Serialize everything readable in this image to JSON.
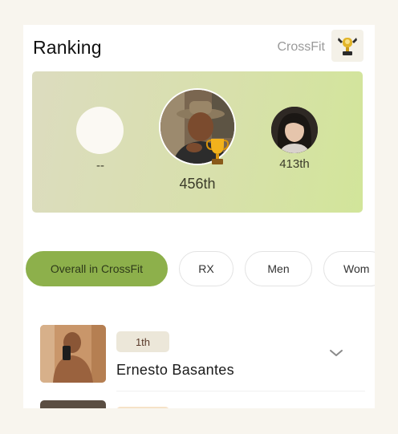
{
  "header": {
    "title": "Ranking",
    "subtitle": "CrossFit",
    "logo_icon": "crossfit-trophy-logo-icon"
  },
  "podium": {
    "left": {
      "rank": "--"
    },
    "center": {
      "rank": "456th",
      "trophy_icon": "trophy-icon"
    },
    "right": {
      "rank": "413th"
    }
  },
  "tabs": [
    {
      "label": "Overall in CrossFit",
      "active": true
    },
    {
      "label": "RX",
      "active": false
    },
    {
      "label": "Men",
      "active": false
    },
    {
      "label": "Wom",
      "active": false
    }
  ],
  "list": [
    {
      "rank": "1th",
      "name": "Ernesto Basantes",
      "icon": "chevron-down-icon"
    }
  ],
  "colors": {
    "accent": "#8db04b",
    "podium_bg": "#d6e2a6",
    "page_bg": "#f8f5ee"
  }
}
